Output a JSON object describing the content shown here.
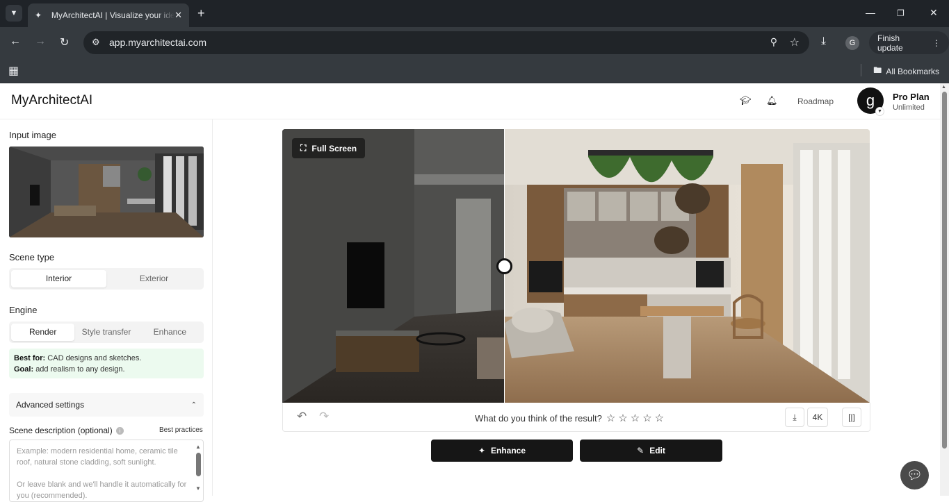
{
  "browser": {
    "tab_title": "MyArchitectAI | Visualize your ideas",
    "url": "app.myarchitectai.com",
    "profile_initial": "G",
    "finish_update": "Finish update",
    "all_bookmarks": "All Bookmarks"
  },
  "header": {
    "logo": "MyArchitectAI",
    "roadmap": "Roadmap",
    "avatar_initial": "g",
    "plan_name": "Pro Plan",
    "plan_sub": "Unlimited"
  },
  "sidebar": {
    "input_image_label": "Input image",
    "scene_type_label": "Scene type",
    "scene_types": [
      "Interior",
      "Exterior"
    ],
    "engine_label": "Engine",
    "engines": [
      "Render",
      "Style transfer",
      "Enhance"
    ],
    "best_for_label": "Best for:",
    "best_for_text": "CAD designs and sketches.",
    "goal_label": "Goal:",
    "goal_text": "add realism to any design.",
    "advanced_settings": "Advanced settings",
    "scene_description_label": "Scene description (optional)",
    "best_practices": "Best practices",
    "scene_description_placeholder_1": "Example: modern residential home, ceramic tile roof, natural stone cladding, soft sunlight.",
    "scene_description_placeholder_2": "Or leave blank and we'll handle it automatically for you (recommended)."
  },
  "viewer": {
    "full_screen": "Full Screen",
    "rating_prompt": "What do you think of the result?",
    "resolution": "4K"
  },
  "actions": {
    "enhance": "Enhance",
    "edit": "Edit"
  }
}
